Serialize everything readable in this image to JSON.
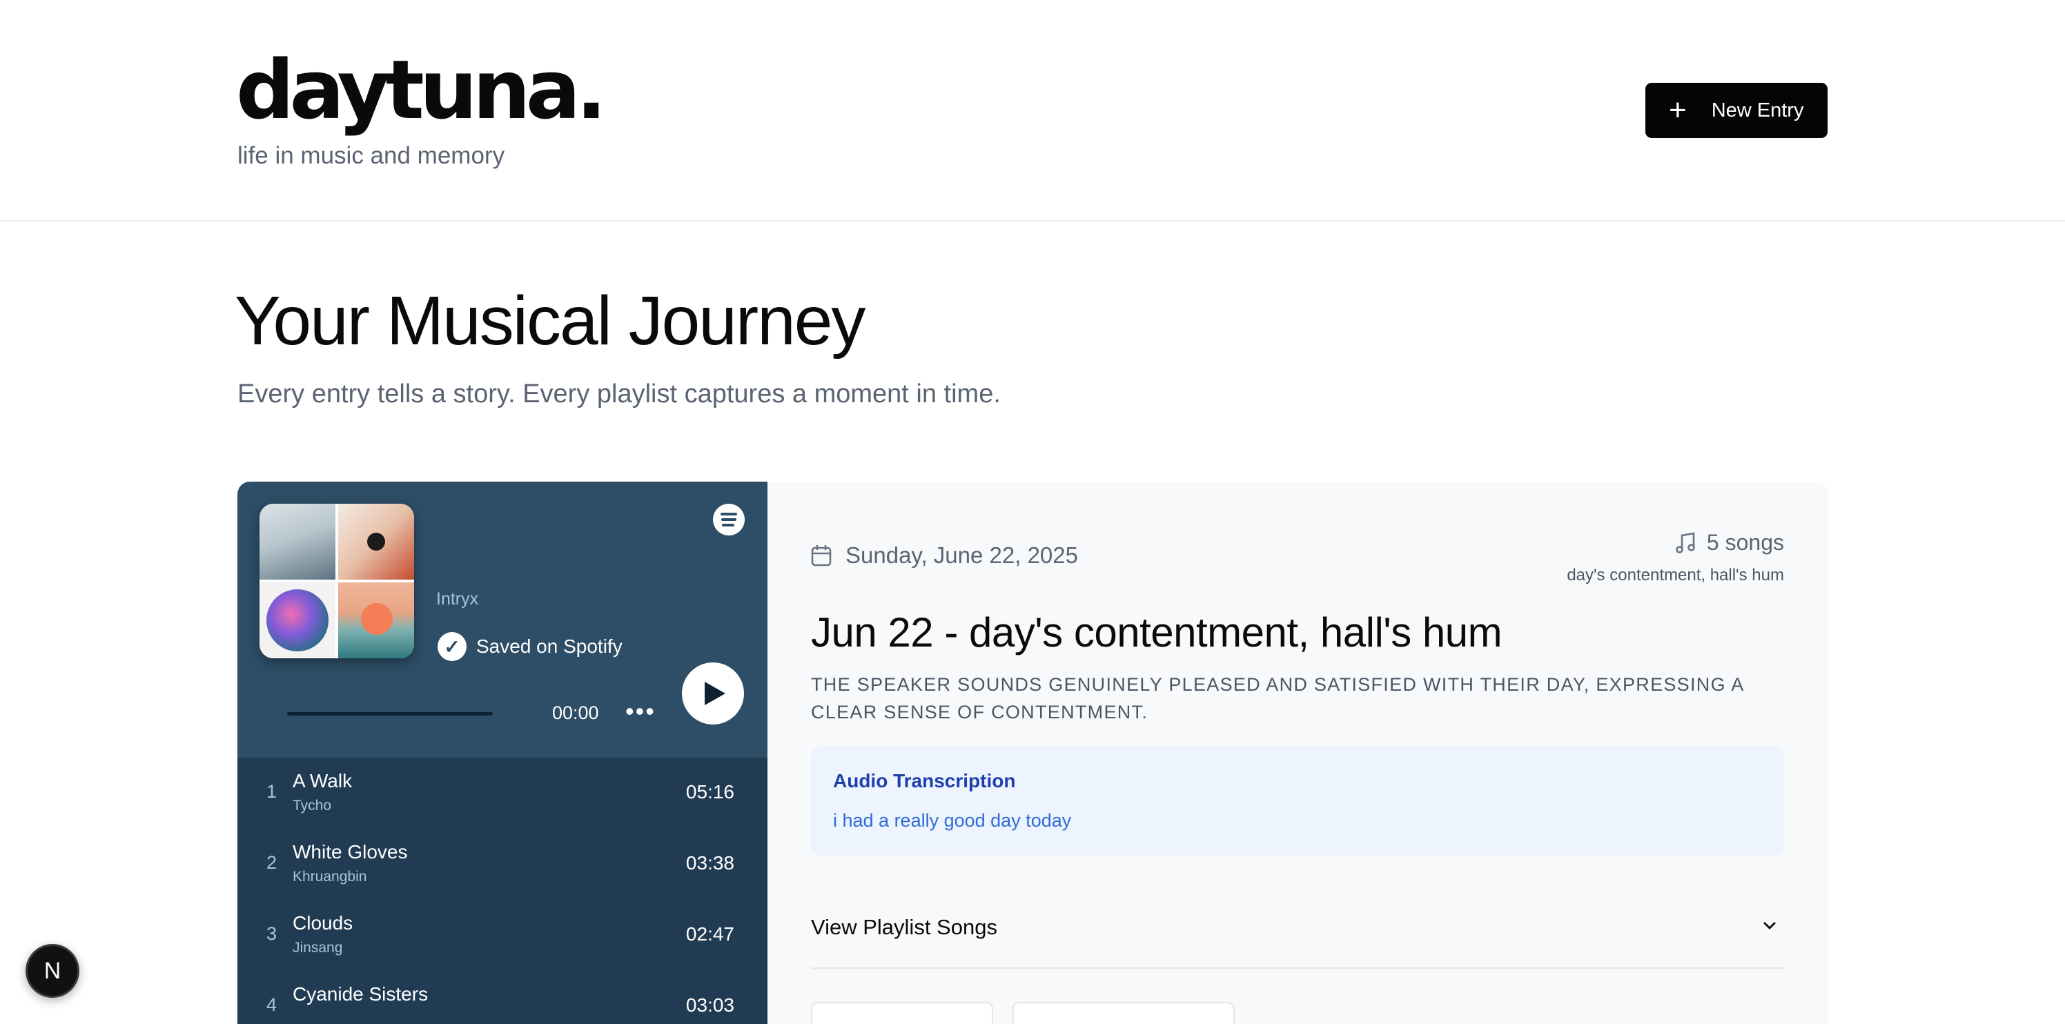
{
  "header": {
    "logo": "daytuna.",
    "tagline": "life in music and memory",
    "new_entry_label": "New Entry"
  },
  "hero": {
    "title": "Your Musical Journey",
    "subtitle": "Every entry tells a story. Every playlist captures a moment in time."
  },
  "player": {
    "artist": "Intryx",
    "saved_label": "Saved on Spotify",
    "time": "00:00",
    "more": "•••",
    "tracks": [
      {
        "num": "1",
        "title": "A Walk",
        "artist": "Tycho",
        "duration": "05:16"
      },
      {
        "num": "2",
        "title": "White Gloves",
        "artist": "Khruangbin",
        "duration": "03:38"
      },
      {
        "num": "3",
        "title": "Clouds",
        "artist": "Jinsang",
        "duration": "02:47"
      },
      {
        "num": "4",
        "title": "Cyanide Sisters",
        "artist": "",
        "duration": "03:03"
      }
    ]
  },
  "entry": {
    "date": "Sunday, June 22, 2025",
    "songs_count": "5 songs",
    "moods": "day's contentment, hall's hum",
    "title": "Jun 22 - day's contentment, hall's hum",
    "summary": "THE SPEAKER SOUNDS GENUINELY PLEASED AND SATISFIED WITH THEIR DAY, EXPRESSING A CLEAR SENSE OF CONTENTMENT.",
    "transcription_label": "Audio Transcription",
    "transcription_text": "i had a really good day today",
    "view_songs_label": "View Playlist Songs"
  },
  "dev_badge": "N",
  "colors": {
    "player_bg": "#2d4e66",
    "tracklist_bg": "#213c52",
    "transcript_bg": "#eef4fd",
    "transcript_label": "#1e40af",
    "primary_button": "#050505"
  }
}
